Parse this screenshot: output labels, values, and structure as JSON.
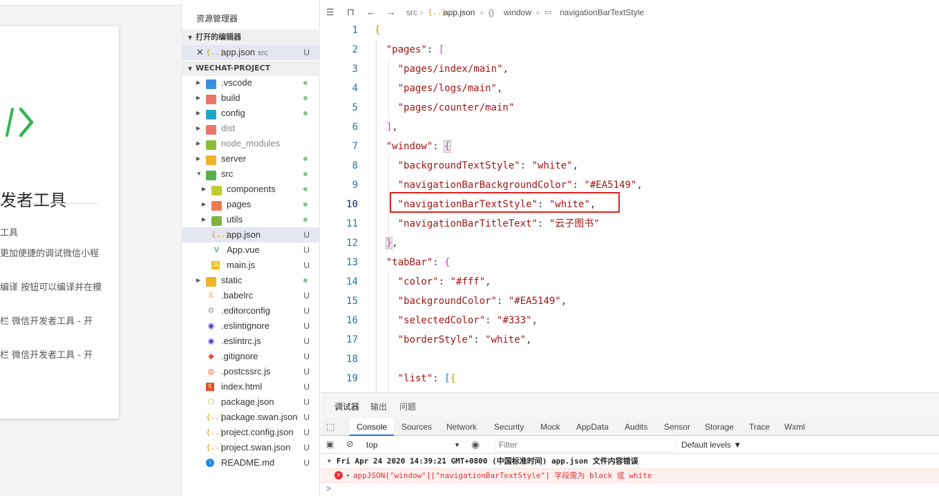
{
  "preview": {
    "title": "发者工具",
    "lines": [
      "工具",
      "更加便捷的调试微信小程",
      "编译 按钮可以编译并在模",
      "栏 微信开发者工具 - 开",
      "栏 微信开发者工具 - 开"
    ],
    "accent": "#2db84d"
  },
  "explorer": {
    "title": "资源管理器",
    "open_editors_label": "打开的编辑器",
    "open_file": {
      "name": "app.json",
      "dir": "src",
      "status": "U"
    },
    "project_label": "WECHAT-PROJECT",
    "items": [
      {
        "name": ".vscode",
        "type": "folder",
        "color": "#3b8fe0",
        "dot": true
      },
      {
        "name": "build",
        "type": "folder",
        "color": "#e8766b",
        "dot": true
      },
      {
        "name": "config",
        "type": "folder",
        "color": "#21a6c8",
        "dot": true
      },
      {
        "name": "dist",
        "type": "folder",
        "color": "#e8766b",
        "dim": true
      },
      {
        "name": "node_modules",
        "type": "folder",
        "color": "#8bbb3a",
        "dim": true
      },
      {
        "name": "server",
        "type": "folder",
        "color": "#f0b429",
        "dot": true
      },
      {
        "name": "src",
        "type": "folder-open",
        "color": "#53b04a",
        "dot": true
      },
      {
        "name": "components",
        "type": "folder",
        "color": "#c0ca33",
        "dot": true
      },
      {
        "name": "pages",
        "type": "folder",
        "color": "#f07850",
        "dot": true
      },
      {
        "name": "utils",
        "type": "folder",
        "color": "#7cb342",
        "dot": true
      },
      {
        "name": "app.json",
        "type": "json",
        "status": "U"
      },
      {
        "name": "App.vue",
        "type": "vue",
        "status": "U"
      },
      {
        "name": "main.js",
        "type": "js",
        "status": "U"
      },
      {
        "name": "static",
        "type": "folder",
        "color": "#f0b429",
        "dot": true
      },
      {
        "name": ".babelrc",
        "type": "babel",
        "status": "U"
      },
      {
        "name": ".editorconfig",
        "type": "editorconfig",
        "status": "U"
      },
      {
        "name": ".eslintignore",
        "type": "eslint",
        "status": "U"
      },
      {
        "name": ".eslintrc.js",
        "type": "eslint",
        "status": "U"
      },
      {
        "name": ".gitignore",
        "type": "git",
        "status": "U"
      },
      {
        "name": ".postcssrc.js",
        "type": "postcss",
        "status": "U"
      },
      {
        "name": "index.html",
        "type": "html",
        "status": "U"
      },
      {
        "name": "package.json",
        "type": "npm",
        "status": "U"
      },
      {
        "name": "package.swan.json",
        "type": "json",
        "status": "U"
      },
      {
        "name": "project.config.json",
        "type": "json",
        "status": "U"
      },
      {
        "name": "project.swan.json",
        "type": "json",
        "status": "U"
      },
      {
        "name": "README.md",
        "type": "info",
        "status": "U"
      }
    ]
  },
  "editor": {
    "breadcrumb": [
      "src",
      "app.json",
      "window",
      "navigationBarTextStyle"
    ],
    "lines": [
      {
        "n": "1"
      },
      {
        "n": "2"
      },
      {
        "n": "3"
      },
      {
        "n": "4"
      },
      {
        "n": "5"
      },
      {
        "n": "6"
      },
      {
        "n": "7"
      },
      {
        "n": "8"
      },
      {
        "n": "9"
      },
      {
        "n": "10"
      },
      {
        "n": "11"
      },
      {
        "n": "12"
      },
      {
        "n": "13"
      },
      {
        "n": "14"
      },
      {
        "n": "15"
      },
      {
        "n": "16"
      },
      {
        "n": "17"
      },
      {
        "n": "18"
      },
      {
        "n": "19"
      }
    ],
    "tokens": {
      "pages": "\"pages\"",
      "index": "\"pages/index/main\"",
      "logs": "\"pages/logs/main\"",
      "counter": "\"pages/counter/main\"",
      "window": "\"window\"",
      "bgTextStyle": "\"backgroundTextStyle\"",
      "white": "\"white\"",
      "navBgColor": "\"navigationBarBackgroundColor\"",
      "ea": "\"#EA5149\"",
      "navTextStyle": "\"navigationBarTextStyle\"",
      "navTitle": "\"navigationBarTitleText\"",
      "title": "\"云子图书\"",
      "tabBar": "\"tabBar\"",
      "color": "\"color\"",
      "fff": "\"#fff\"",
      "bgColor": "\"backgroundColor\"",
      "selectedColor": "\"selectedColor\"",
      "c333": "\"#333\"",
      "borderStyle": "\"borderStyle\"",
      "list": "\"list\""
    }
  },
  "panel": {
    "tabs": [
      "调试器",
      "输出",
      "问题"
    ],
    "devtools_tabs": [
      "Console",
      "Sources",
      "Network",
      "Security",
      "Mock",
      "AppData",
      "Audits",
      "Sensor",
      "Storage",
      "Trace",
      "Wxml"
    ],
    "context": "top",
    "filter_placeholder": "Filter",
    "levels": "Default levels ▼",
    "log_group": "Fri Apr 24 2020 14:39:21 GMT+0800 (中国标准时间)  app.json 文件内容错误",
    "log_error": "appJSON[\"window\"][\"navigationBarTextStyle\"] 字段需为 black 或 white",
    "prompt": ">"
  }
}
